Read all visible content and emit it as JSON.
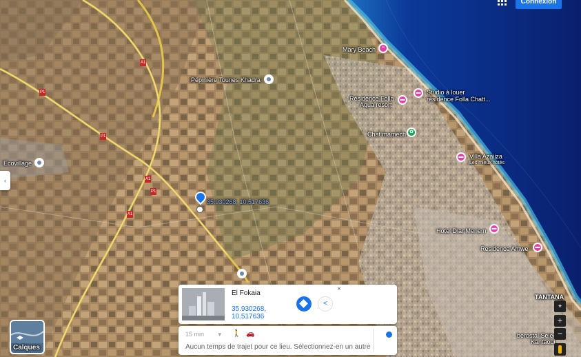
{
  "header": {
    "connexion_label": "Connexion",
    "apps_icon": "apps-grid-icon"
  },
  "map": {
    "type": "satellite",
    "places": [
      {
        "id": "mary-beach",
        "label": "Mary Beach",
        "icon": "beach-pin-icon"
      },
      {
        "id": "pepiniere",
        "label": "Pépinière Tounes Khadra",
        "icon": "place-pin-icon"
      },
      {
        "id": "studio",
        "label": "Studio à louer",
        "sub": "résidence Folla Chatt...",
        "icon": "hotel-pin-icon"
      },
      {
        "id": "residence-folla",
        "label": "Résidence Folla",
        "sub": "Aqua resort",
        "icon": "hotel-pin-icon"
      },
      {
        "id": "chat-mamech",
        "label": "Chat mamech",
        "icon": "park-pin-icon"
      },
      {
        "id": "villa",
        "label": "Villa Azaiiza",
        "sub": "Les mieux notés",
        "icon": "hotel-pin-icon"
      },
      {
        "id": "ecovillage",
        "label": "Ecovillage",
        "icon": "place-pin-icon"
      },
      {
        "id": "hotel-diar",
        "label": "Hotel Diar Meriem",
        "icon": "hotel-pin-icon"
      },
      {
        "id": "residence-amwe",
        "label": "Residence Amwe",
        "icon": "hotel-pin-icon"
      },
      {
        "id": "tantana",
        "label": "TANTANA"
      },
      {
        "id": "berostal",
        "label": "berostal Selec",
        "sub": "Kantaoui"
      }
    ],
    "dropped_pin": {
      "label": "35.930268, 10.517636"
    },
    "road_labels": [
      "P1",
      "A1",
      "P1",
      "A1",
      "P1",
      "A1"
    ]
  },
  "side_panel_toggle": {
    "glyph": "‹"
  },
  "place_card": {
    "title": "El Fokaia",
    "coord_lat": "35.930268,",
    "coord_lon": "10.517636",
    "close": "×",
    "directions_icon": "directions-icon",
    "share_icon": "share-icon"
  },
  "travel": {
    "time_select": "15 min",
    "caret": "▾",
    "walk_icon": "walk-icon",
    "car_icon": "car-icon",
    "message": "Aucun temps de trajet pour ce lieu. Sélectionnez-en un autre"
  },
  "layers": {
    "label": "Calques",
    "icon": "layers-icon"
  },
  "controls": {
    "zoom_in": "+",
    "zoom_out": "−",
    "compass_icon": "compass-icon",
    "pegman_icon": "pegman-icon"
  },
  "colors": {
    "accent": "#1a73e8",
    "hotel": "#e03fa8",
    "park": "#25a05a",
    "sea": "#0b2b7a"
  }
}
